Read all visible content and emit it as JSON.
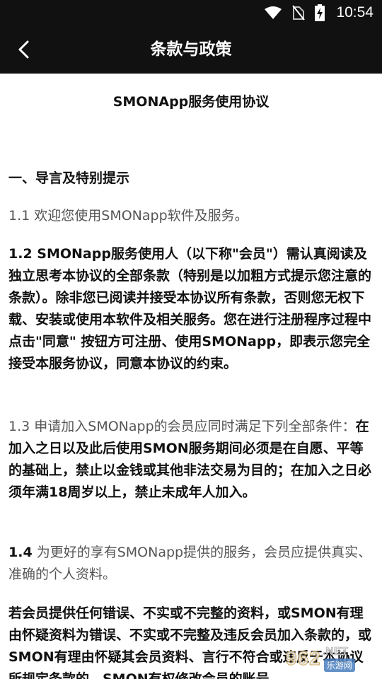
{
  "status_bar": {
    "time": "10:54",
    "icons": [
      "wifi-icon",
      "no-sim-icon",
      "battery-charging-icon"
    ]
  },
  "app_bar": {
    "title": "条款与政策",
    "back_icon": "chevron-left-icon"
  },
  "document": {
    "title": "SMONApp服务使用协议",
    "section_heading": "一、导言及特别提示",
    "p1_1": "1.1 欢迎您使用SMONapp软件及服务。",
    "p1_2": "1.2 SMONapp服务使用人（以下称\"会员\"）需认真阅读及独立思考本协议的全部条款（特别是以加粗方式提示您注意的条款）。除非您已阅读并接受本协议所有条款，否则您无权下载、安装或使用本软件及相关服务。您在进行注册程序过程中点击\"同意\" 按钮方可注册、使用SMONapp，即表示您完全接受本服务协议，同意本协议的约束。",
    "p1_3_prefix": "1.3 申请加入SMONapp的会员应同时满足下列全部条件：",
    "p1_3_bold": "在加入之日以及此后使用SMON服务期间必须是在自愿、平等的基础上，禁止以金钱或其他非法交易为目的；在加入之日必须年满18周岁以上，禁止未成年人加入。",
    "p1_4_num": "1.4",
    "p1_4_text": " 为更好的享有SMONapp提供的服务，会员应提供真实、准确的个人资料。",
    "p_last": "若会员提供任何错误、不实或不完整的资料，或SMON有理由怀疑资料为错误、不实或不完整及违反会员加入条款的，或SMON有理由怀疑其会员资料、言行不符合或违反于本协议所规定条款的，SMON有权修改会员的账号"
  },
  "watermark": {
    "logo": "962",
    "suffix": ".NET",
    "sub": "乐游网"
  },
  "colors": {
    "bar_background": "#111111",
    "bar_text": "#ffffff",
    "page_background": "#ffffff",
    "gray_text": "#555555"
  }
}
